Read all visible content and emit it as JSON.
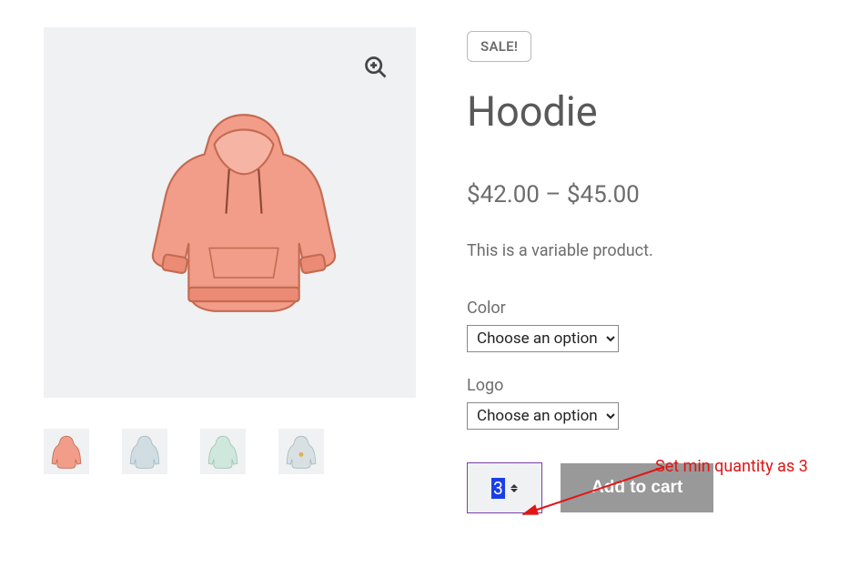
{
  "sale_badge": "SALE!",
  "title": "Hoodie",
  "price": "$42.00 – $45.00",
  "description": "This is a variable product.",
  "variations": {
    "color": {
      "label": "Color",
      "placeholder": "Choose an option"
    },
    "logo": {
      "label": "Logo",
      "placeholder": "Choose an option"
    }
  },
  "quantity": "3",
  "add_to_cart": "Add to cart",
  "annotation": "Set min quantity as 3",
  "thumb_colors": {
    "main_fill": "#f29d8a",
    "main_stroke": "#c46b52",
    "t1": "#f29d8a",
    "t2": "#d0dee4",
    "t3": "#cfe7dc",
    "t4": "#d9e0e4"
  }
}
